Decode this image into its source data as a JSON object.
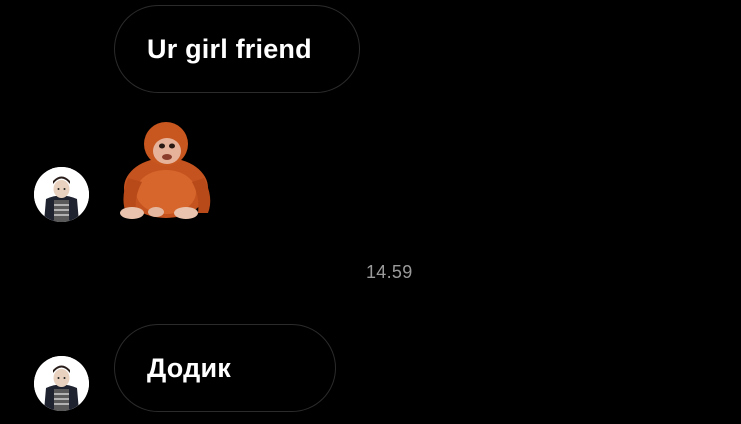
{
  "messages": [
    {
      "type": "text",
      "text": "Ur girl friend"
    },
    {
      "type": "sticker",
      "icon": "orangutan-sticker"
    },
    {
      "type": "text",
      "text": "Додик"
    }
  ],
  "timestamp": "14.59",
  "colors": {
    "background": "#000000",
    "bubble_border": "#2b2b2b",
    "text": "#ffffff",
    "timestamp": "#9a9a9a"
  }
}
